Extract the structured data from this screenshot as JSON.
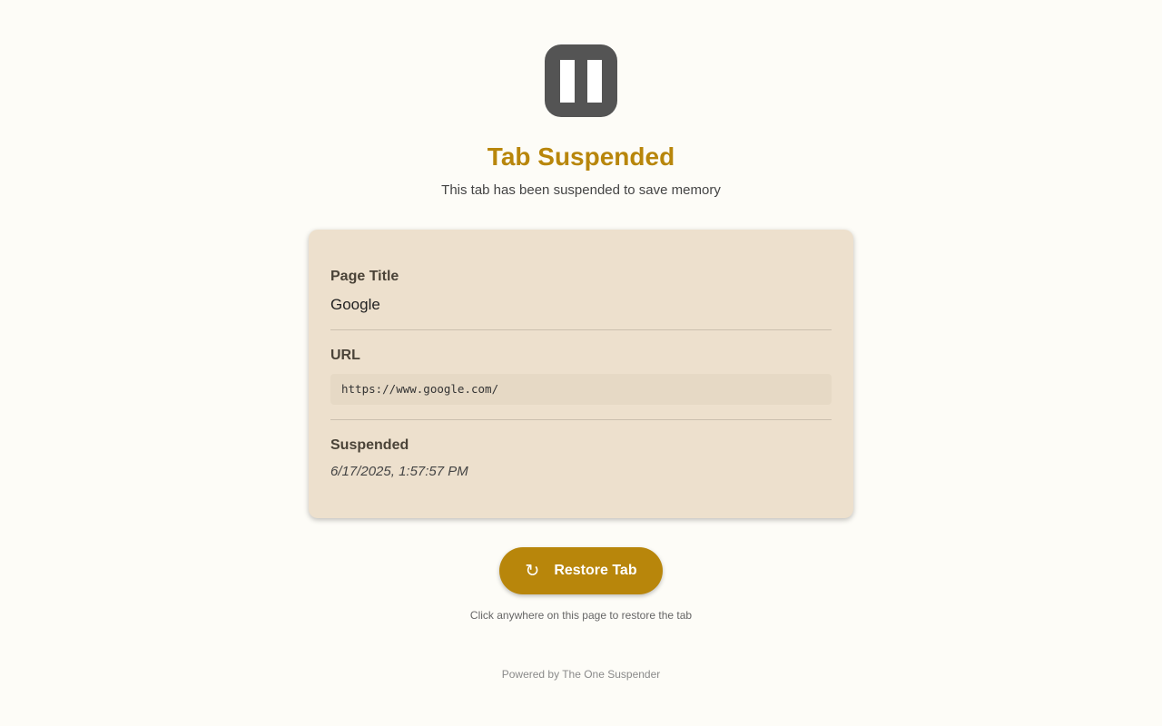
{
  "header": {
    "icon": "pause-icon",
    "title": "Tab Suspended",
    "subtitle": "This tab has been suspended to save memory"
  },
  "details": {
    "page_title_label": "Page Title",
    "page_title_value": "Google",
    "url_label": "URL",
    "url_value": "https://www.google.com/",
    "suspended_label": "Suspended",
    "suspended_value": "6/17/2025, 1:57:57 PM"
  },
  "restore_button": {
    "icon": "refresh-icon",
    "glyph": "↻",
    "label": "Restore Tab"
  },
  "hint": "Click anywhere on this page to restore the tab",
  "footer": "Powered by The One Suspender",
  "colors": {
    "accent": "#b8860b",
    "background": "#fdfcf7",
    "card": "#ede0cd",
    "icon_bg": "#545454"
  }
}
